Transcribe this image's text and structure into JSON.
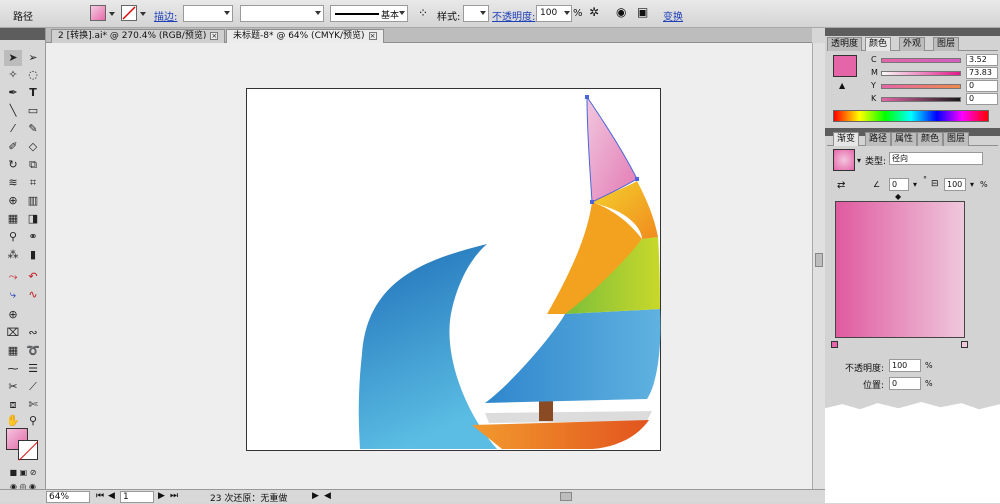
{
  "control_bar": {
    "path_label": "路径",
    "stroke_link": "描边:",
    "stroke_width_value": "",
    "brush_value": "基本",
    "style_label": "样式:",
    "opacity_link": "不透明度:",
    "opacity_value": "100",
    "opacity_unit": "%",
    "transform_link": "变换"
  },
  "tabs": [
    {
      "label": "2 [转换].ai* @ 270.4% (RGB/预览)"
    },
    {
      "label": "未标题-8* @ 64% (CMYK/预览)"
    }
  ],
  "status_bar": {
    "zoom": "64%",
    "page": "1",
    "undo_text": "23 次还原：无重做"
  },
  "color_panel": {
    "tabs": [
      "透明度",
      "颜色",
      "外观",
      "图层"
    ],
    "channels": [
      {
        "label": "C",
        "value": "3.52",
        "unit": "%"
      },
      {
        "label": "M",
        "value": "73.83",
        "unit": "%"
      },
      {
        "label": "Y",
        "value": "0",
        "unit": "%"
      },
      {
        "label": "K",
        "value": "0",
        "unit": "%"
      }
    ],
    "fill_color": "#e466a8"
  },
  "gradient_panel": {
    "tabs": [
      "渐变",
      "路径",
      "属性",
      "颜色",
      "图层"
    ],
    "type_label": "类型:",
    "type_value": "径向",
    "angle_value": "0",
    "angle_unit": "°",
    "aspect_value": "100",
    "aspect_unit": "%",
    "opacity_label": "不透明度:",
    "opacity_value": "100",
    "opacity_unit": "%",
    "location_label": "位置:",
    "location_value": "0",
    "location_unit": "%",
    "start_color": "#e05aa0",
    "end_color": "#efc8dc"
  },
  "artwork": {
    "sail_colors": [
      "#e994c3",
      "#f5d22c",
      "#f08a1e",
      "#9ccf2e",
      "#3a93d4"
    ],
    "wave_colors": [
      "#1f6fb8",
      "#5bbde3"
    ],
    "hull_colors": [
      "#f29a2e",
      "#e2541e"
    ],
    "mast_color": "#8a4a24"
  }
}
